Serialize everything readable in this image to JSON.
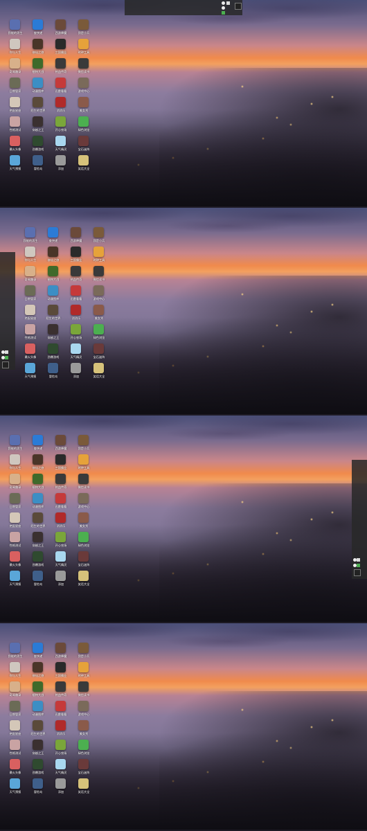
{
  "colors": {
    "tile": [
      "#3a6fd1",
      "#d65a3a",
      "#2b8a3e",
      "#6c4a8a",
      "#c23b3b",
      "#e0a03a",
      "#2c7cc4",
      "#7a5a3a",
      "#5b9b2d",
      "#a33b7a",
      "#3aa0a0",
      "#8a8a8a"
    ]
  },
  "icons": [
    {
      "label": "我能的男生",
      "icon": "avatar-icon",
      "color": "#5a6fb0"
    },
    {
      "label": "你与人生",
      "icon": "character-icon",
      "color": "#cfc7bf"
    },
    {
      "label": "奇闻趣录",
      "icon": "face-icon",
      "color": "#d8b08a"
    },
    {
      "label": "日期管家",
      "icon": "calendar-icon",
      "color": "#6b6b56"
    },
    {
      "label": "绝配星座",
      "icon": "zodiac-icon",
      "color": "#d4c7b8"
    },
    {
      "label": "性格测试",
      "icon": "puzzle-icon",
      "color": "#c9a3a3"
    },
    {
      "label": "最火头像",
      "icon": "portrait-icon",
      "color": "#d96060"
    },
    {
      "label": "天气预报",
      "icon": "weather-icon",
      "color": "#5aa6d8"
    },
    {
      "label": "查快递",
      "icon": "search-icon",
      "color": "#2b7bd6"
    },
    {
      "label": "修仙之旅",
      "icon": "game-icon",
      "color": "#4a3528"
    },
    {
      "label": "植物大战",
      "icon": "plant-icon",
      "color": "#3f6a2a"
    },
    {
      "label": "动漫图库",
      "icon": "anime-icon",
      "color": "#3c8ec4"
    },
    {
      "label": "陌生的世界",
      "icon": "story-icon",
      "color": "#5a4a3a"
    },
    {
      "label": "穿越之王",
      "icon": "hero-icon",
      "color": "#3a3030"
    },
    {
      "label": "劲爆游戏",
      "icon": "action-icon",
      "color": "#2f4a2f"
    },
    {
      "label": "冒险岛",
      "icon": "island-icon",
      "color": "#3f5f8a"
    },
    {
      "label": "西游降魔",
      "icon": "monkey-icon",
      "color": "#6b4a3a"
    },
    {
      "label": "三国霸业",
      "icon": "warrior-icon",
      "color": "#2a2a2a"
    },
    {
      "label": "热血传奇",
      "icon": "sword-icon",
      "color": "#3a3a3a"
    },
    {
      "label": "迅雷看看",
      "icon": "video-icon",
      "color": "#c53a3a"
    },
    {
      "label": "消消乐",
      "icon": "candy-icon",
      "color": "#b02a2a"
    },
    {
      "label": "开心农场",
      "icon": "farm-icon",
      "color": "#7aa63a"
    },
    {
      "label": "天气精灵",
      "icon": "cloud-icon",
      "color": "#a9d7ef"
    },
    {
      "label": "添加",
      "icon": "plus-icon",
      "color": "#9a9a9a"
    },
    {
      "label": "我是小兵",
      "icon": "soldier-icon",
      "color": "#7a5a3a"
    },
    {
      "label": "时钟工具",
      "icon": "clock-icon",
      "color": "#e6a23a"
    },
    {
      "label": "微信读书",
      "icon": "book-icon",
      "color": "#3a3a3a"
    },
    {
      "label": "游戏中心",
      "icon": "controller-icon",
      "color": "#7a6a5a"
    },
    {
      "label": "美女秀",
      "icon": "photo-icon",
      "color": "#8a5a4a"
    },
    {
      "label": "绿色浏览",
      "icon": "browser-icon",
      "color": "#4caf50"
    },
    {
      "label": "宝石迷阵",
      "icon": "gem-icon",
      "color": "#6a3a3a"
    },
    {
      "label": "笑话大全",
      "icon": "joke-icon",
      "color": "#d6c27a"
    }
  ],
  "dock": {
    "tabs": [
      "1",
      "2",
      "3",
      "4"
    ],
    "active": "2"
  }
}
